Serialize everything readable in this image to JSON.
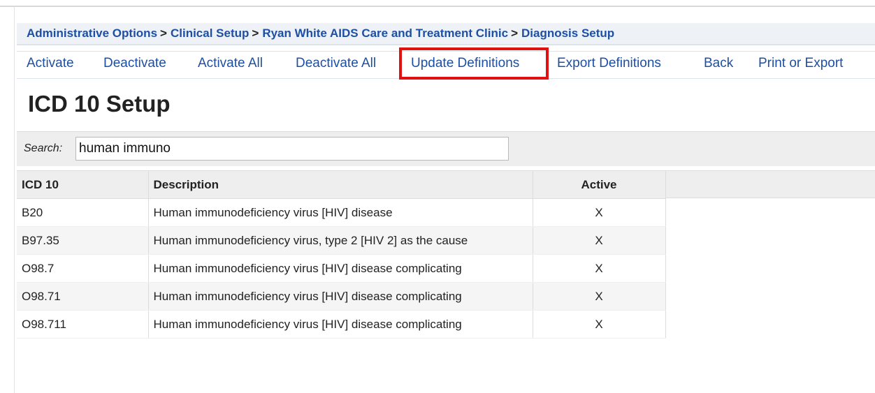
{
  "breadcrumb": [
    {
      "label": "Administrative Options"
    },
    {
      "label": "Clinical Setup"
    },
    {
      "label": "Ryan White AIDS Care and Treatment Clinic"
    },
    {
      "label": "Diagnosis Setup"
    }
  ],
  "breadcrumb_separator": ">",
  "actions": {
    "activate": "Activate",
    "deactivate": "Deactivate",
    "activate_all": "Activate All",
    "deactivate_all": "Deactivate All",
    "update_definitions": "Update Definitions",
    "export_definitions": "Export Definitions",
    "back": "Back",
    "print_or_export": "Print or Export"
  },
  "highlighted_action": "update_definitions",
  "page_title": "ICD 10 Setup",
  "search": {
    "label": "Search:",
    "value": "human immuno"
  },
  "table": {
    "columns": [
      "ICD 10",
      "Description",
      "Active"
    ],
    "rows": [
      {
        "code": "B20",
        "description": "Human immunodeficiency virus [HIV] disease",
        "active": "X"
      },
      {
        "code": "B97.35",
        "description": "Human immunodeficiency virus, type 2 [HIV 2] as the cause",
        "active": "X"
      },
      {
        "code": "O98.7",
        "description": "Human immunodeficiency virus [HIV] disease complicating",
        "active": "X"
      },
      {
        "code": "O98.71",
        "description": "Human immunodeficiency virus [HIV] disease complicating",
        "active": "X"
      },
      {
        "code": "O98.711",
        "description": "Human immunodeficiency virus [HIV] disease complicating",
        "active": "X"
      }
    ]
  },
  "colors": {
    "link": "#1d4fa4",
    "highlight_border": "#e0120f",
    "header_bg": "#eeeeee"
  }
}
